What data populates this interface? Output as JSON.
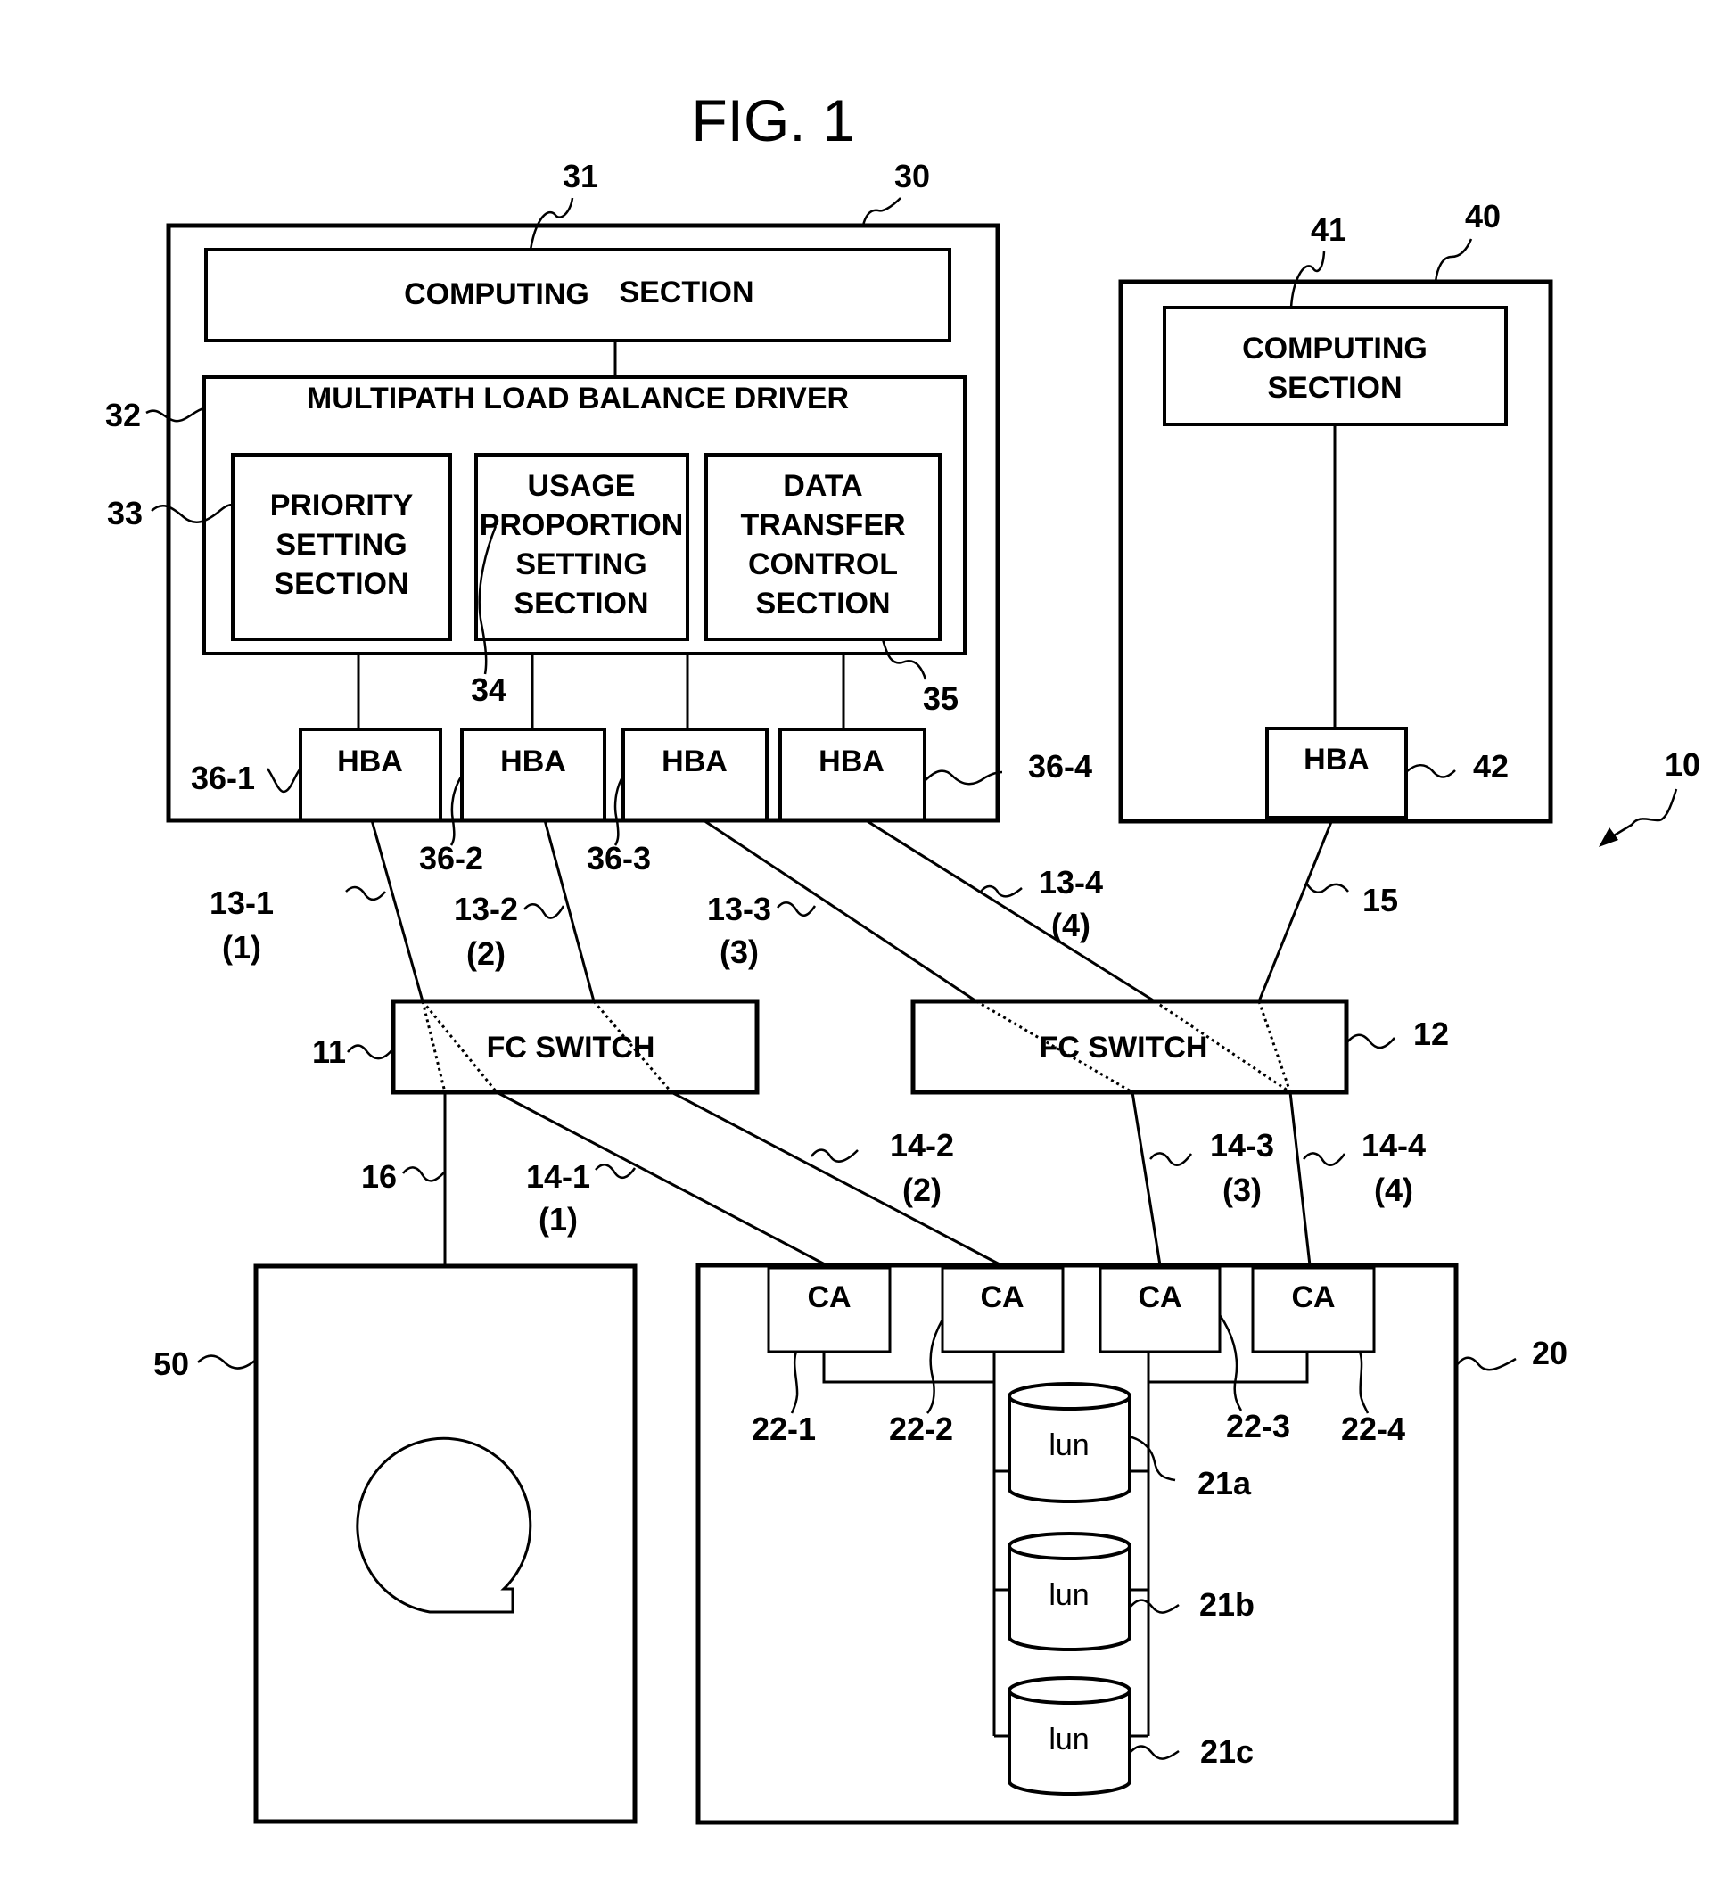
{
  "figure": {
    "title": "FIG. 1",
    "system_ref": "10"
  },
  "host_30": {
    "ref": "30",
    "computing_section": {
      "ref": "31",
      "label_left": "COMPUTING",
      "label_right": "SECTION"
    },
    "driver": {
      "ref": "32",
      "label": "MULTIPATH LOAD BALANCE DRIVER",
      "sections": [
        {
          "ref": "33",
          "lines": [
            "PRIORITY",
            "SETTING",
            "SECTION"
          ]
        },
        {
          "ref": "34",
          "lines": [
            "USAGE",
            "PROPORTION",
            "SETTING",
            "SECTION"
          ]
        },
        {
          "ref": "35",
          "lines": [
            "DATA",
            "TRANSFER",
            "CONTROL",
            "SECTION"
          ]
        }
      ]
    },
    "hbas": [
      {
        "ref": "36-1",
        "label": "HBA"
      },
      {
        "ref": "36-2",
        "label": "HBA"
      },
      {
        "ref": "36-3",
        "label": "HBA"
      },
      {
        "ref": "36-4",
        "label": "HBA"
      }
    ]
  },
  "host_40": {
    "ref": "40",
    "computing_section": {
      "ref": "41",
      "lines": [
        "COMPUTING",
        "SECTION"
      ]
    },
    "hba": {
      "ref": "42",
      "label": "HBA"
    }
  },
  "switches": [
    {
      "ref": "11",
      "label": "FC SWITCH"
    },
    {
      "ref": "12",
      "label": "FC SWITCH"
    }
  ],
  "host_paths": [
    {
      "ref": "13-1",
      "index": "(1)"
    },
    {
      "ref": "13-2",
      "index": "(2)"
    },
    {
      "ref": "13-3",
      "index": "(3)"
    },
    {
      "ref": "13-4",
      "index": "(4)"
    }
  ],
  "storage_paths": [
    {
      "ref": "14-1",
      "index": "(1)"
    },
    {
      "ref": "14-2",
      "index": "(2)"
    },
    {
      "ref": "14-3",
      "index": "(3)"
    },
    {
      "ref": "14-4",
      "index": "(4)"
    }
  ],
  "other_links": {
    "host40_link": "15",
    "tape_link": "16"
  },
  "storage_20": {
    "ref": "20",
    "channel_adapters": [
      {
        "ref": "22-1",
        "label": "CA"
      },
      {
        "ref": "22-2",
        "label": "CA"
      },
      {
        "ref": "22-3",
        "label": "CA"
      },
      {
        "ref": "22-4",
        "label": "CA"
      }
    ],
    "luns": [
      {
        "ref": "21a",
        "label": "lun"
      },
      {
        "ref": "21b",
        "label": "lun"
      },
      {
        "ref": "21c",
        "label": "lun"
      }
    ]
  },
  "tape_50": {
    "ref": "50",
    "icon": "tape-reel-icon"
  }
}
